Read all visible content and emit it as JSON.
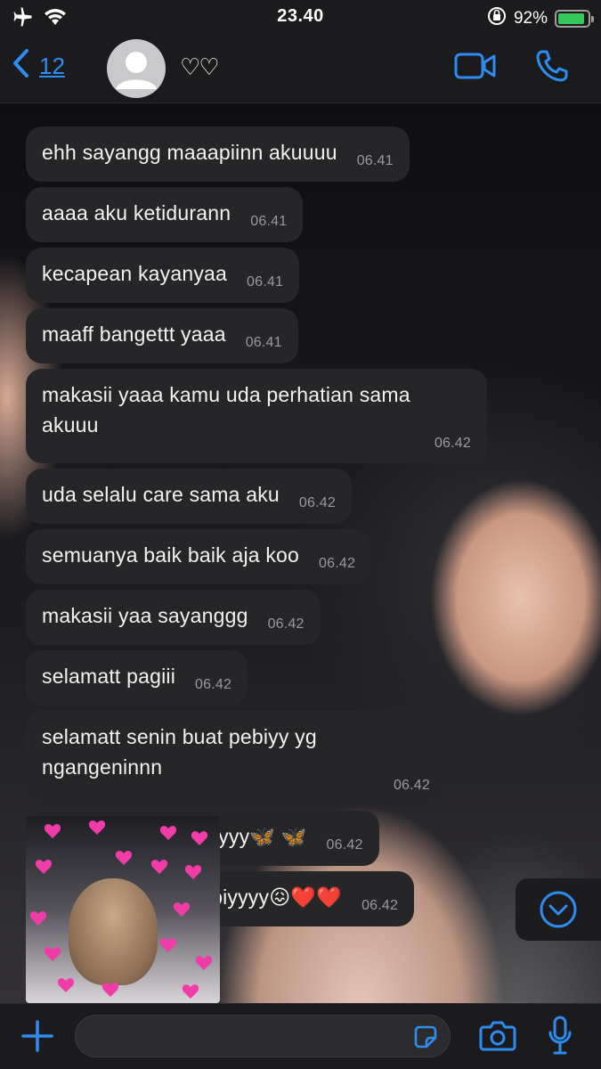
{
  "status_bar": {
    "time": "23.40",
    "battery_percent": "92%",
    "battery_level": 0.92,
    "icons": [
      "airplane-icon",
      "wifi-icon",
      "orientation-lock-icon",
      "battery-charging-icon"
    ]
  },
  "header": {
    "back_count": "12",
    "contact_name": "♡♡",
    "icons": [
      "chevron-left-icon",
      "avatar-placeholder-icon",
      "video-call-icon",
      "phone-icon"
    ]
  },
  "messages": [
    {
      "text": "ehh sayangg maaapiinn akuuuu",
      "time": "06.41"
    },
    {
      "text": "aaaa aku ketidurann",
      "time": "06.41"
    },
    {
      "text": "kecapean kayanyaa",
      "time": "06.41"
    },
    {
      "text": "maaff bangettt yaaa",
      "time": "06.41"
    },
    {
      "text": "makasii yaaa kamu uda perhatian sama akuuu",
      "time": "06.42"
    },
    {
      "text": "uda selalu care sama aku",
      "time": "06.42"
    },
    {
      "text": "semuanya baik baik aja koo",
      "time": "06.42"
    },
    {
      "text": "makasii yaa sayanggg",
      "time": "06.42"
    },
    {
      "text": "selamatt pagiii",
      "time": "06.42"
    },
    {
      "text": "selamatt senin buat pebiyy yg ngangeninnn",
      "time": "06.42"
    },
    {
      "text": "have a nice fo todayyy🦋 🦋",
      "time": "06.42"
    },
    {
      "text": "tiyoo sayanggg pebiyyyy😖❤️❤️",
      "time": "06.42"
    }
  ],
  "sticker": {
    "description_icon": "kitten-hearts-sticker"
  },
  "input_bar": {
    "placeholder": "",
    "icons": [
      "plus-icon",
      "sticker-icon",
      "camera-icon",
      "microphone-icon"
    ]
  },
  "colors": {
    "accent": "#2f8cf0",
    "bubble": "#262628",
    "bar": "#1b1b1d",
    "battery": "#35c759"
  }
}
